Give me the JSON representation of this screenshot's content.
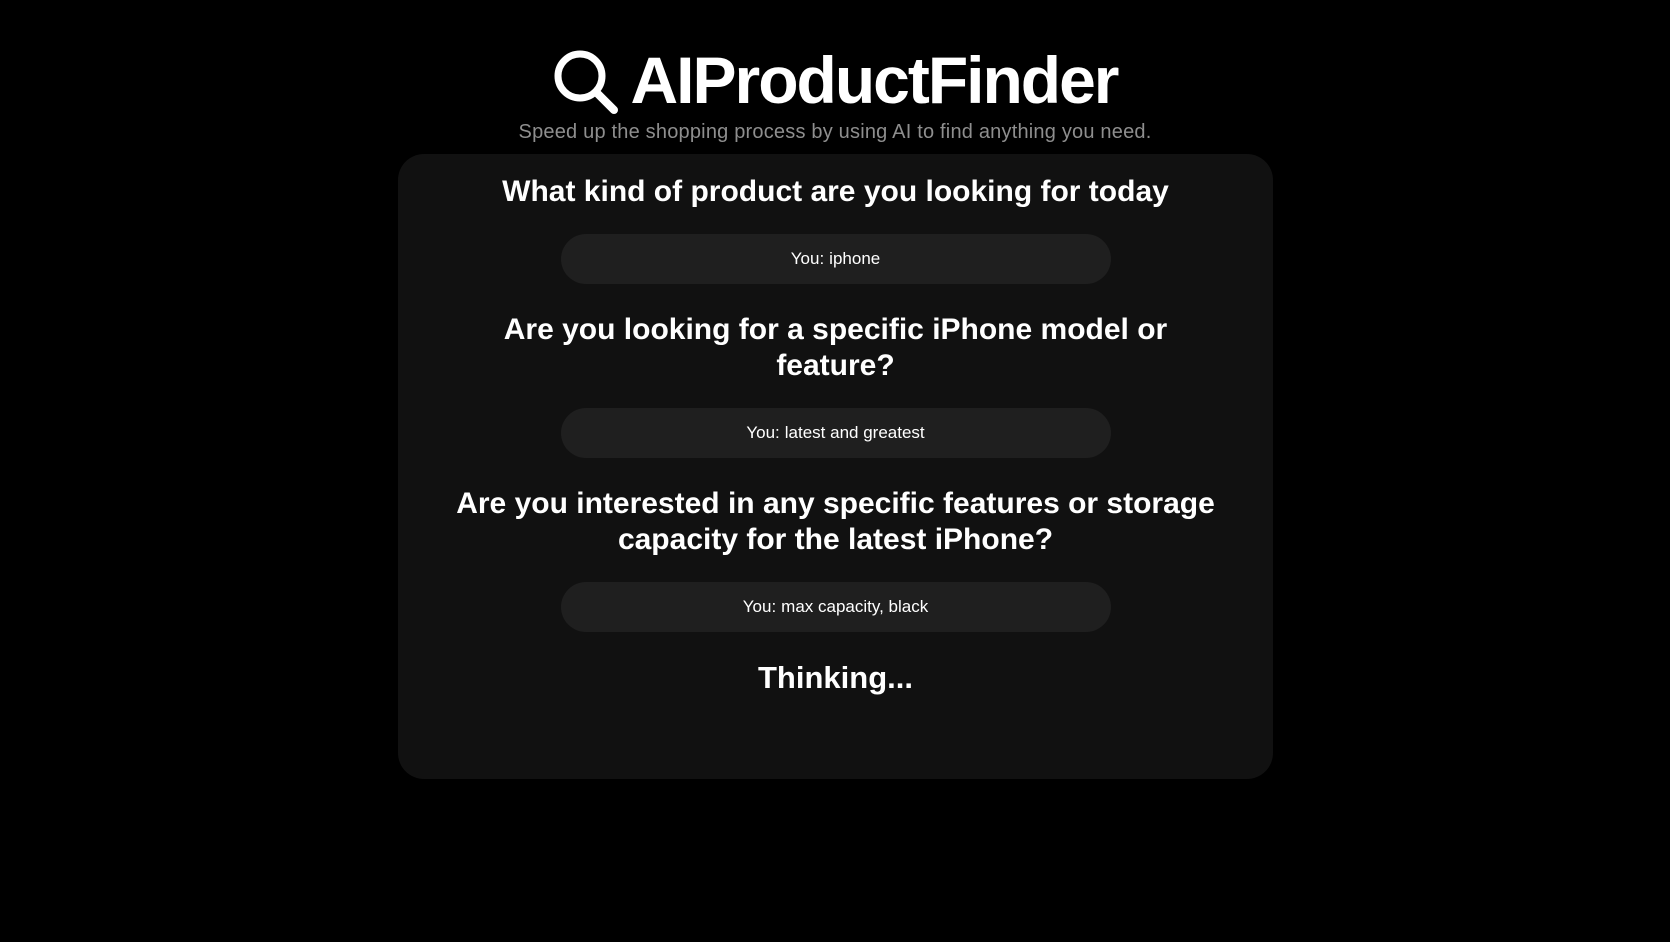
{
  "app": {
    "title": "AIProductFinder",
    "tagline": "Speed up the shopping process by using AI to find anything you need.",
    "logo_icon": "search-icon"
  },
  "conversation": {
    "answer_prefix": "You:",
    "turns": [
      {
        "question": "What kind of product are you looking for today",
        "answer": "iphone"
      },
      {
        "question": "Are you looking for a specific iPhone model or feature?",
        "answer": "latest and greatest"
      },
      {
        "question": "Are you interested in any specific features or storage capacity for the latest iPhone?",
        "answer": "max capacity, black"
      }
    ],
    "status": "Thinking..."
  },
  "colors": {
    "background": "#000000",
    "card": "#111111",
    "answer_bubble": "#1f1f1f",
    "tagline": "#8e8e8e",
    "text": "#ffffff"
  }
}
